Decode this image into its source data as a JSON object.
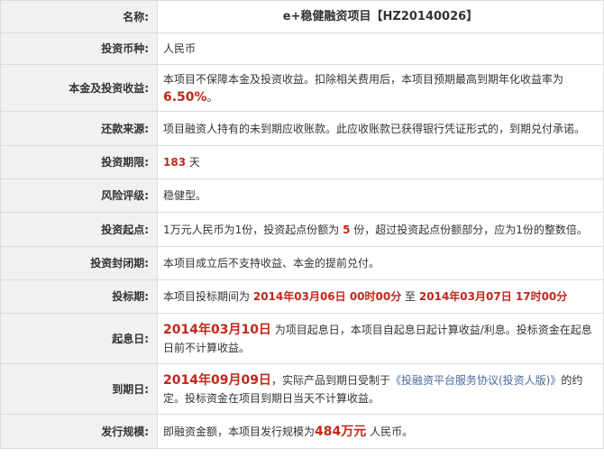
{
  "rows": {
    "name": {
      "label": "名称:",
      "value": "e+稳健融资项目【HZ20140026】"
    },
    "currency": {
      "label": "投资币种:",
      "value": "人民币"
    },
    "return": {
      "label": "本金及投资收益:",
      "text": "本项目不保障本金及投资收益。扣除相关费用后，本项目预期最高到期年化收益率为",
      "rate": "6.50%",
      "suffix": "。"
    },
    "source": {
      "label": "还款来源:",
      "value": "项目融资人持有的未到期应收账款。此应收账款已获得银行凭证形式的，到期兑付承诺。"
    },
    "term": {
      "label": "投资期限:",
      "days": "183",
      "unit": "天"
    },
    "risk": {
      "label": "风险评级:",
      "value": "稳健型。"
    },
    "minimum": {
      "label": "投资起点:",
      "pre": "1万元人民币为1份，投资起点份额为",
      "num": "5",
      "post": "份，超过投资起点份额部分，应为1份的整数倍。"
    },
    "lockup": {
      "label": "投资封闭期:",
      "value": "本项目成立后不支持收益、本金的提前兑付。"
    },
    "bidding": {
      "label": "投标期:",
      "pre": "本项目投标期间为",
      "start": "2014年03月06日 00时00分",
      "mid": "至",
      "end": "2014年03月07日 17时00分"
    },
    "value_date": {
      "label": "起息日:",
      "date": "2014年03月10日",
      "text": "为项目起息日，本项目自起息日起计算收益/利息。投标资金在起息日前不计算收益。"
    },
    "maturity": {
      "label": "到期日:",
      "date": "2014年09月09日",
      "text1": "，实际产品到期日受制于",
      "link": "《投融资平台服务协议(投资人版)》",
      "text2": "的约定。投标资金在项目到期日当天不计算收益。"
    },
    "size": {
      "label": "发行规模:",
      "pre": "即融资金额，本项目发行规模为",
      "amount": "484万元",
      "post": "人民币。"
    }
  },
  "colors": {
    "highlight": "#c0281b",
    "label_bg": "#f1f1f1",
    "border": "#dcdcdc",
    "link": "#4a6ba0"
  }
}
